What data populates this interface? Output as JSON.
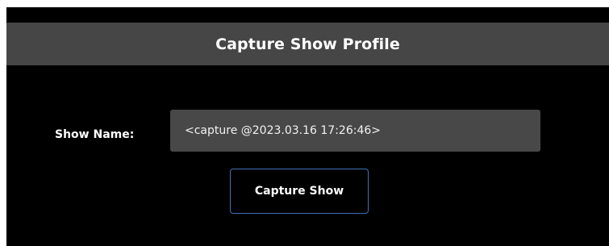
{
  "dialog": {
    "title": "Capture Show Profile"
  },
  "form": {
    "show_name_label": "Show Name:",
    "show_name_value": "",
    "show_name_placeholder": "<capture @2023.03.16 17:26:46>"
  },
  "actions": {
    "capture_label": "Capture Show"
  },
  "colors": {
    "title_bar_bg": "#464646",
    "dialog_bg": "#000000",
    "input_bg": "#484848",
    "button_border": "#3f6fb8",
    "text": "#ffffff"
  }
}
